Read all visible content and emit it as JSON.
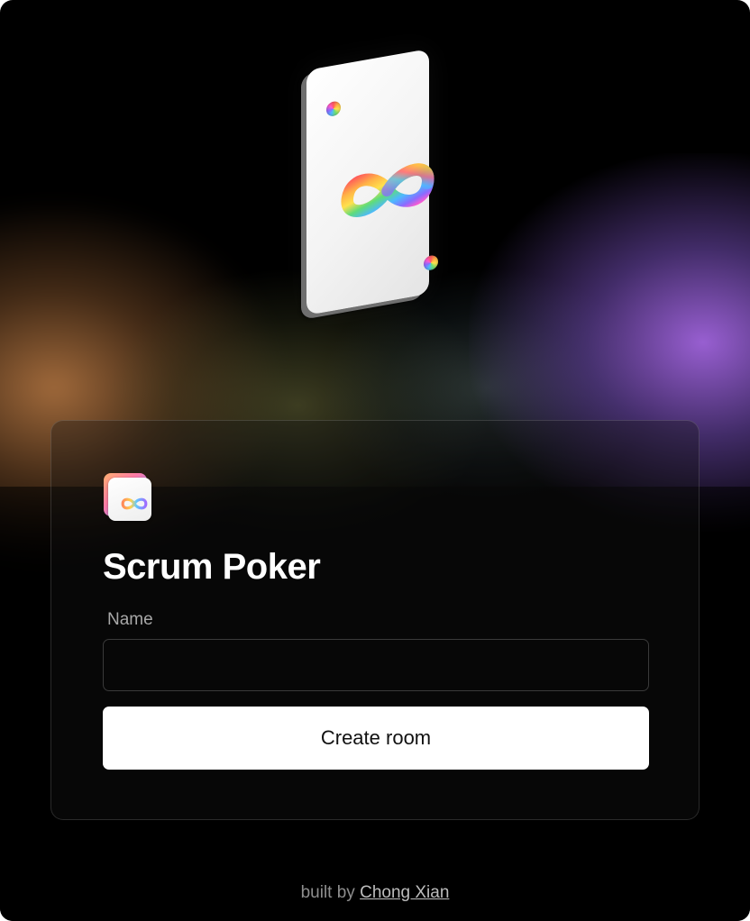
{
  "app": {
    "title": "Scrum Poker"
  },
  "form": {
    "name_label": "Name",
    "name_value": "",
    "submit_label": "Create room"
  },
  "footer": {
    "prefix": "built by",
    "author_link": "Chong Xian"
  },
  "icons": {
    "hero": "playing-card-infinity-icon",
    "logo": "app-logo-infinity-icon"
  },
  "colors": {
    "background": "#000000",
    "button_bg": "#ffffff",
    "button_text": "#111111",
    "label_text": "#a8a8a8",
    "footer_text": "#8e8e8e",
    "glow_orange": "#be7d46",
    "glow_purple": "#a064dc"
  }
}
